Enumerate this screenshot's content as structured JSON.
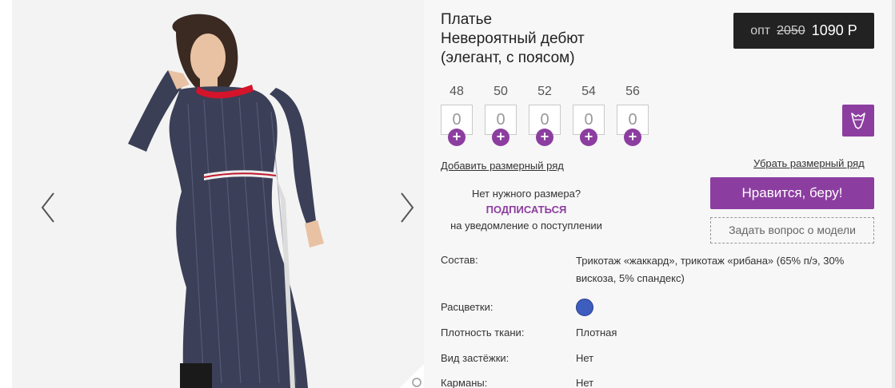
{
  "product": {
    "title_line1": "Платье",
    "title_line2": "Невероятный дебют",
    "title_line3": "(элегант, с поясом)"
  },
  "price": {
    "label": "опт",
    "old": "2050",
    "new": "1090 Р"
  },
  "sizes": [
    {
      "label": "48",
      "qty": "0"
    },
    {
      "label": "50",
      "qty": "0"
    },
    {
      "label": "52",
      "qty": "0"
    },
    {
      "label": "54",
      "qty": "0"
    },
    {
      "label": "56",
      "qty": "0"
    }
  ],
  "actions": {
    "add_row": "Добавить размерный ряд",
    "remove_row": "Убрать размерный ряд",
    "buy": "Нравится, беру!",
    "ask": "Задать вопрос о модели"
  },
  "notify": {
    "line1": "Нет нужного размера?",
    "subscribe": "ПОДПИСАТЬСЯ",
    "line3": "на уведомление о поступлении"
  },
  "specs": {
    "composition_label": "Состав:",
    "composition_value": "Трикотаж «жаккард», трикотаж «рибана» (65% п/э, 30% вискоза, 5% спандекс)",
    "colors_label": "Расцветки:",
    "density_label": "Плотность ткани:",
    "density_value": "Плотная",
    "fastener_label": "Вид застёжки:",
    "fastener_value": "Нет",
    "pockets_label": "Карманы:",
    "pockets_value": "Нет"
  },
  "colors": {
    "accent": "#8c3ea0",
    "swatch": "#3d5dbf",
    "price_bg": "#222222"
  }
}
